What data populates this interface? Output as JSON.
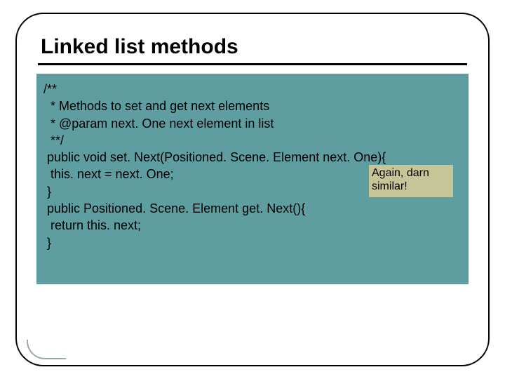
{
  "slide": {
    "title": "Linked list methods",
    "note": "Again, darn similar!",
    "code_lines": [
      "/**",
      "  * Methods to set and get next elements",
      "  * @param next. One next element in list",
      "  **/",
      " public void set. Next(Positioned. Scene. Element next. One){",
      "  this. next = next. One;",
      " }",
      "",
      " public Positioned. Scene. Element get. Next(){",
      "  return this. next;",
      " }"
    ]
  }
}
